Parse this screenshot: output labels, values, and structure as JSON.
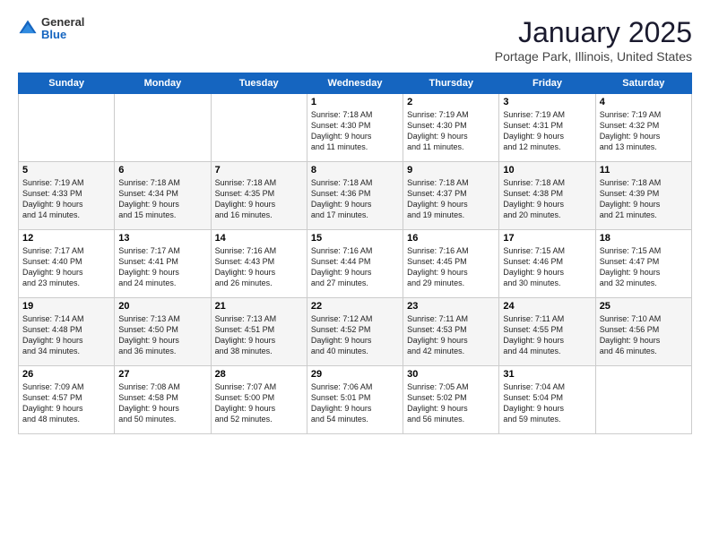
{
  "logo": {
    "general": "General",
    "blue": "Blue"
  },
  "header": {
    "title": "January 2025",
    "location": "Portage Park, Illinois, United States"
  },
  "weekdays": [
    "Sunday",
    "Monday",
    "Tuesday",
    "Wednesday",
    "Thursday",
    "Friday",
    "Saturday"
  ],
  "weeks": [
    [
      {
        "day": "",
        "info": ""
      },
      {
        "day": "",
        "info": ""
      },
      {
        "day": "",
        "info": ""
      },
      {
        "day": "1",
        "info": "Sunrise: 7:18 AM\nSunset: 4:30 PM\nDaylight: 9 hours\nand 11 minutes."
      },
      {
        "day": "2",
        "info": "Sunrise: 7:19 AM\nSunset: 4:30 PM\nDaylight: 9 hours\nand 11 minutes."
      },
      {
        "day": "3",
        "info": "Sunrise: 7:19 AM\nSunset: 4:31 PM\nDaylight: 9 hours\nand 12 minutes."
      },
      {
        "day": "4",
        "info": "Sunrise: 7:19 AM\nSunset: 4:32 PM\nDaylight: 9 hours\nand 13 minutes."
      }
    ],
    [
      {
        "day": "5",
        "info": "Sunrise: 7:19 AM\nSunset: 4:33 PM\nDaylight: 9 hours\nand 14 minutes."
      },
      {
        "day": "6",
        "info": "Sunrise: 7:18 AM\nSunset: 4:34 PM\nDaylight: 9 hours\nand 15 minutes."
      },
      {
        "day": "7",
        "info": "Sunrise: 7:18 AM\nSunset: 4:35 PM\nDaylight: 9 hours\nand 16 minutes."
      },
      {
        "day": "8",
        "info": "Sunrise: 7:18 AM\nSunset: 4:36 PM\nDaylight: 9 hours\nand 17 minutes."
      },
      {
        "day": "9",
        "info": "Sunrise: 7:18 AM\nSunset: 4:37 PM\nDaylight: 9 hours\nand 19 minutes."
      },
      {
        "day": "10",
        "info": "Sunrise: 7:18 AM\nSunset: 4:38 PM\nDaylight: 9 hours\nand 20 minutes."
      },
      {
        "day": "11",
        "info": "Sunrise: 7:18 AM\nSunset: 4:39 PM\nDaylight: 9 hours\nand 21 minutes."
      }
    ],
    [
      {
        "day": "12",
        "info": "Sunrise: 7:17 AM\nSunset: 4:40 PM\nDaylight: 9 hours\nand 23 minutes."
      },
      {
        "day": "13",
        "info": "Sunrise: 7:17 AM\nSunset: 4:41 PM\nDaylight: 9 hours\nand 24 minutes."
      },
      {
        "day": "14",
        "info": "Sunrise: 7:16 AM\nSunset: 4:43 PM\nDaylight: 9 hours\nand 26 minutes."
      },
      {
        "day": "15",
        "info": "Sunrise: 7:16 AM\nSunset: 4:44 PM\nDaylight: 9 hours\nand 27 minutes."
      },
      {
        "day": "16",
        "info": "Sunrise: 7:16 AM\nSunset: 4:45 PM\nDaylight: 9 hours\nand 29 minutes."
      },
      {
        "day": "17",
        "info": "Sunrise: 7:15 AM\nSunset: 4:46 PM\nDaylight: 9 hours\nand 30 minutes."
      },
      {
        "day": "18",
        "info": "Sunrise: 7:15 AM\nSunset: 4:47 PM\nDaylight: 9 hours\nand 32 minutes."
      }
    ],
    [
      {
        "day": "19",
        "info": "Sunrise: 7:14 AM\nSunset: 4:48 PM\nDaylight: 9 hours\nand 34 minutes."
      },
      {
        "day": "20",
        "info": "Sunrise: 7:13 AM\nSunset: 4:50 PM\nDaylight: 9 hours\nand 36 minutes."
      },
      {
        "day": "21",
        "info": "Sunrise: 7:13 AM\nSunset: 4:51 PM\nDaylight: 9 hours\nand 38 minutes."
      },
      {
        "day": "22",
        "info": "Sunrise: 7:12 AM\nSunset: 4:52 PM\nDaylight: 9 hours\nand 40 minutes."
      },
      {
        "day": "23",
        "info": "Sunrise: 7:11 AM\nSunset: 4:53 PM\nDaylight: 9 hours\nand 42 minutes."
      },
      {
        "day": "24",
        "info": "Sunrise: 7:11 AM\nSunset: 4:55 PM\nDaylight: 9 hours\nand 44 minutes."
      },
      {
        "day": "25",
        "info": "Sunrise: 7:10 AM\nSunset: 4:56 PM\nDaylight: 9 hours\nand 46 minutes."
      }
    ],
    [
      {
        "day": "26",
        "info": "Sunrise: 7:09 AM\nSunset: 4:57 PM\nDaylight: 9 hours\nand 48 minutes."
      },
      {
        "day": "27",
        "info": "Sunrise: 7:08 AM\nSunset: 4:58 PM\nDaylight: 9 hours\nand 50 minutes."
      },
      {
        "day": "28",
        "info": "Sunrise: 7:07 AM\nSunset: 5:00 PM\nDaylight: 9 hours\nand 52 minutes."
      },
      {
        "day": "29",
        "info": "Sunrise: 7:06 AM\nSunset: 5:01 PM\nDaylight: 9 hours\nand 54 minutes."
      },
      {
        "day": "30",
        "info": "Sunrise: 7:05 AM\nSunset: 5:02 PM\nDaylight: 9 hours\nand 56 minutes."
      },
      {
        "day": "31",
        "info": "Sunrise: 7:04 AM\nSunset: 5:04 PM\nDaylight: 9 hours\nand 59 minutes."
      },
      {
        "day": "",
        "info": ""
      }
    ]
  ]
}
